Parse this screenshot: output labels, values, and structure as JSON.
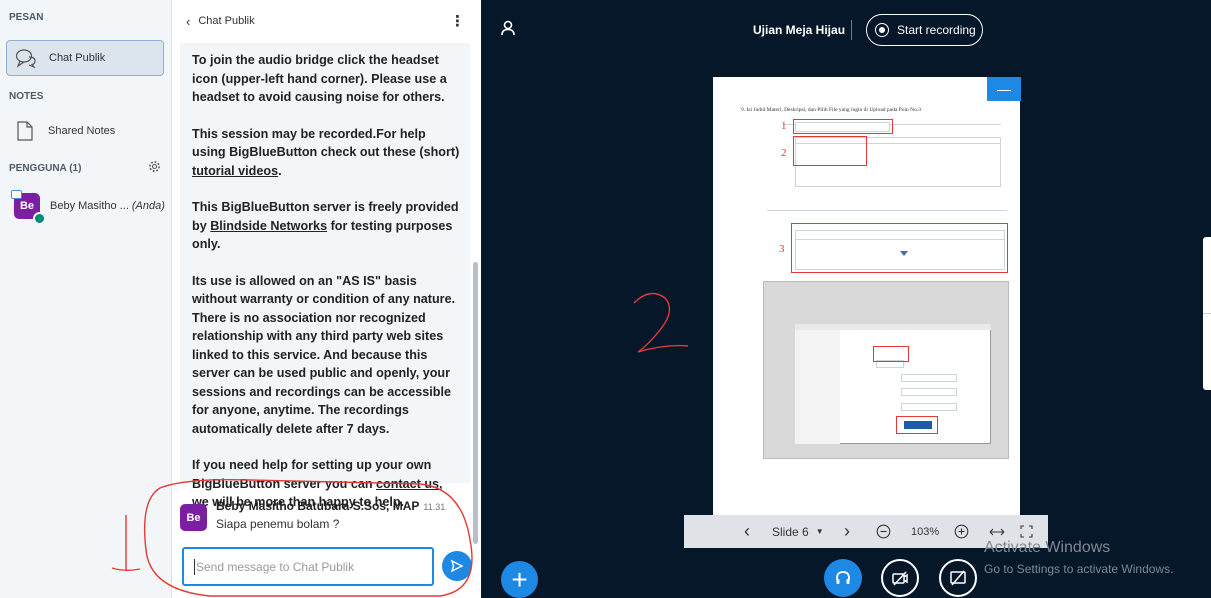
{
  "sidebar": {
    "messages_title": "PESAN",
    "public_chat_label": "Chat Publik",
    "notes_title": "NOTES",
    "shared_notes_label": "Shared Notes",
    "users_title": "PENGGUNA (1)",
    "user": {
      "initials": "Be",
      "name": "Beby Masitho ...",
      "you_tag": "(Anda)"
    }
  },
  "chat": {
    "header_title": "Chat Publik",
    "welcome": {
      "p1": "To join the audio bridge click the headset icon (upper-left hand corner). Please use a headset to avoid causing noise for others.",
      "p2_before": "This session may be recorded.For help using BigBlueButton check out these (short) ",
      "p2_link": "tutorial videos",
      "p2_after": ".",
      "p3_before": "This BigBlueButton server is freely provided by ",
      "p3_link": "Blindside Networks",
      "p3_after": " for testing purposes only.",
      "p4": "Its use is allowed on an \"AS IS\" basis without warranty or condition of any nature. There is no association nor recognized relationship with any third party web sites linked to this service. And because this server can be used public and openly, your sessions and recordings can be accessible for anyone, anytime. The recordings automatically delete after 7 days.",
      "p5_before": "If you need help for setting up your own BigBlueButton server you can ",
      "p5_link": "contact us",
      "p5_after": ", we will be more than happy to help."
    },
    "message": {
      "initials": "Be",
      "sender": "Beby Masitho Batubara S.Sos, MAP",
      "time": "11.31",
      "text": "Siapa penemu bolam ?"
    },
    "input_placeholder": "Send message to Chat Publik"
  },
  "stage": {
    "meeting_title": "Ujian Meja Hijau",
    "record_label": "Start recording",
    "slide": {
      "heading": "9.   Isi Judul Materi, Deskripsi, dan Pilih File yang ingin di Upload pada Poin No.3",
      "marks": [
        "1",
        "2",
        "3"
      ]
    },
    "toolbar": {
      "slide_label": "Slide 6",
      "zoom": "103%"
    },
    "annotation": "2"
  },
  "chat_annotation": "1",
  "watermark": {
    "title": "Activate Windows",
    "subtitle": "Go to Settings to activate Windows."
  },
  "colors": {
    "accent": "#1e88e5",
    "stage_bg": "#06172a",
    "annotation": "#e53935",
    "avatar": "#7b1fa2"
  }
}
